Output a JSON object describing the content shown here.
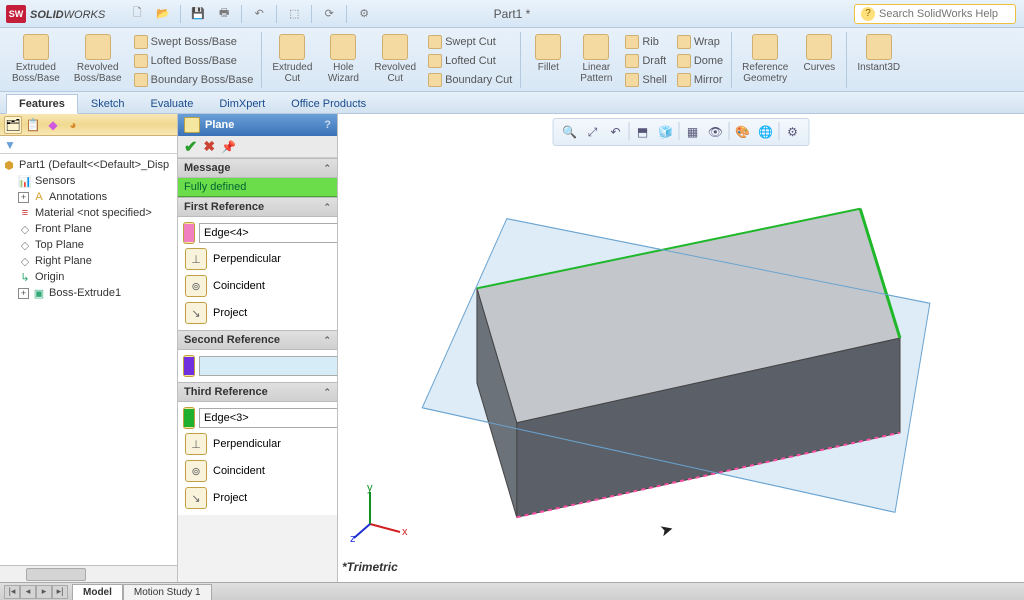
{
  "app": {
    "logo": "SW",
    "name_bold": "SOLID",
    "name_light": "WORKS",
    "doc": "Part1 *",
    "search_placeholder": "Search SolidWorks Help"
  },
  "ribbon": {
    "extruded": "Extruded\nBoss/Base",
    "revolved": "Revolved\nBoss/Base",
    "swept": "Swept Boss/Base",
    "lofted": "Lofted Boss/Base",
    "boundary": "Boundary Boss/Base",
    "extcut": "Extruded\nCut",
    "hole": "Hole\nWizard",
    "revcut": "Revolved\nCut",
    "sweptcut": "Swept Cut",
    "loftcut": "Lofted Cut",
    "bndcut": "Boundary Cut",
    "fillet": "Fillet",
    "pattern": "Linear\nPattern",
    "rib": "Rib",
    "draft": "Draft",
    "shell": "Shell",
    "wrap": "Wrap",
    "dome": "Dome",
    "mirror": "Mirror",
    "refgeo": "Reference\nGeometry",
    "curves": "Curves",
    "instant": "Instant3D"
  },
  "tabs": {
    "t1": "Features",
    "t2": "Sketch",
    "t3": "Evaluate",
    "t4": "DimXpert",
    "t5": "Office Products"
  },
  "tree": {
    "root": "Part1 (Default<<Default>_Disp",
    "sensors": "Sensors",
    "annot": "Annotations",
    "mat": "Material <not specified>",
    "front": "Front Plane",
    "top": "Top Plane",
    "right": "Right Plane",
    "origin": "Origin",
    "extr": "Boss-Extrude1"
  },
  "pm": {
    "title": "Plane",
    "msg_h": "Message",
    "msg": "Fully defined",
    "ref1_h": "First Reference",
    "ref1_val": "Edge<4>",
    "perp": "Perpendicular",
    "coinc": "Coincident",
    "proj": "Project",
    "ref2_h": "Second Reference",
    "ref2_val": "",
    "ref3_h": "Third Reference",
    "ref3_val": "Edge<3>"
  },
  "view": {
    "orient": "*Trimetric"
  },
  "btabs": {
    "model": "Model",
    "motion": "Motion Study 1"
  }
}
